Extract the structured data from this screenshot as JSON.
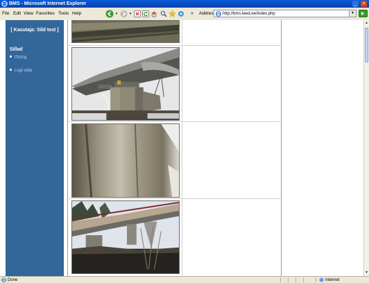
{
  "window": {
    "title": "BMS - Microsoft Internet Explorer",
    "controls": {
      "minimize": "_",
      "maximize": "□",
      "close": "×"
    }
  },
  "menu": [
    "File",
    "Edit",
    "View",
    "Favorites",
    "Tools",
    "Help"
  ],
  "toolbar": {
    "back_icon": "back-arrow-icon",
    "forward_icon": "forward-arrow-icon",
    "more_label": "»",
    "address_label": "Address",
    "url": "http://bms.teed.ee/index.php"
  },
  "sidebar": {
    "user_label": "[ Kasutaja: Sild test ]",
    "section_title": "Sillad",
    "links": [
      {
        "label": "Otsing"
      },
      {
        "label": "Logi välja"
      }
    ]
  },
  "photos": [
    {
      "desc": "bridge-deck-closeup"
    },
    {
      "desc": "bridge-pier-underside"
    },
    {
      "desc": "concrete-beam-underside"
    },
    {
      "desc": "bridge-side-view-river"
    }
  ],
  "status": {
    "text": "Done",
    "zone": "Internet"
  },
  "colors": {
    "sidebar": "#336699",
    "titlebar": "#0a5bd8",
    "chrome": "#ece9d8"
  }
}
